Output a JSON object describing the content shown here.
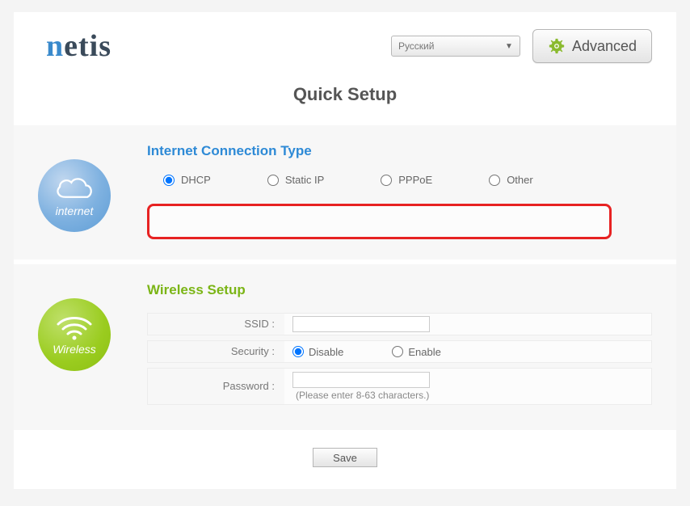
{
  "header": {
    "logo": "netis",
    "language_selected": "Русский",
    "advanced_label": "Advanced"
  },
  "page_title": "Quick Setup",
  "internet": {
    "section_title": "Internet Connection Type",
    "badge_label": "internet",
    "options": {
      "dhcp": "DHCP",
      "static_ip": "Static IP",
      "pppoe": "PPPoE",
      "other": "Other"
    },
    "selected": "dhcp"
  },
  "wireless": {
    "section_title": "Wireless Setup",
    "badge_label": "Wireless",
    "ssid_label": "SSID :",
    "ssid_value": "",
    "security_label": "Security :",
    "security_options": {
      "disable": "Disable",
      "enable": "Enable"
    },
    "security_selected": "disable",
    "password_label": "Password :",
    "password_value": "",
    "password_hint": "(Please enter 8-63 characters.)"
  },
  "save_label": "Save",
  "colors": {
    "internet_accent": "#2e8ad6",
    "wireless_accent": "#7bb516",
    "highlight": "#e72222"
  }
}
